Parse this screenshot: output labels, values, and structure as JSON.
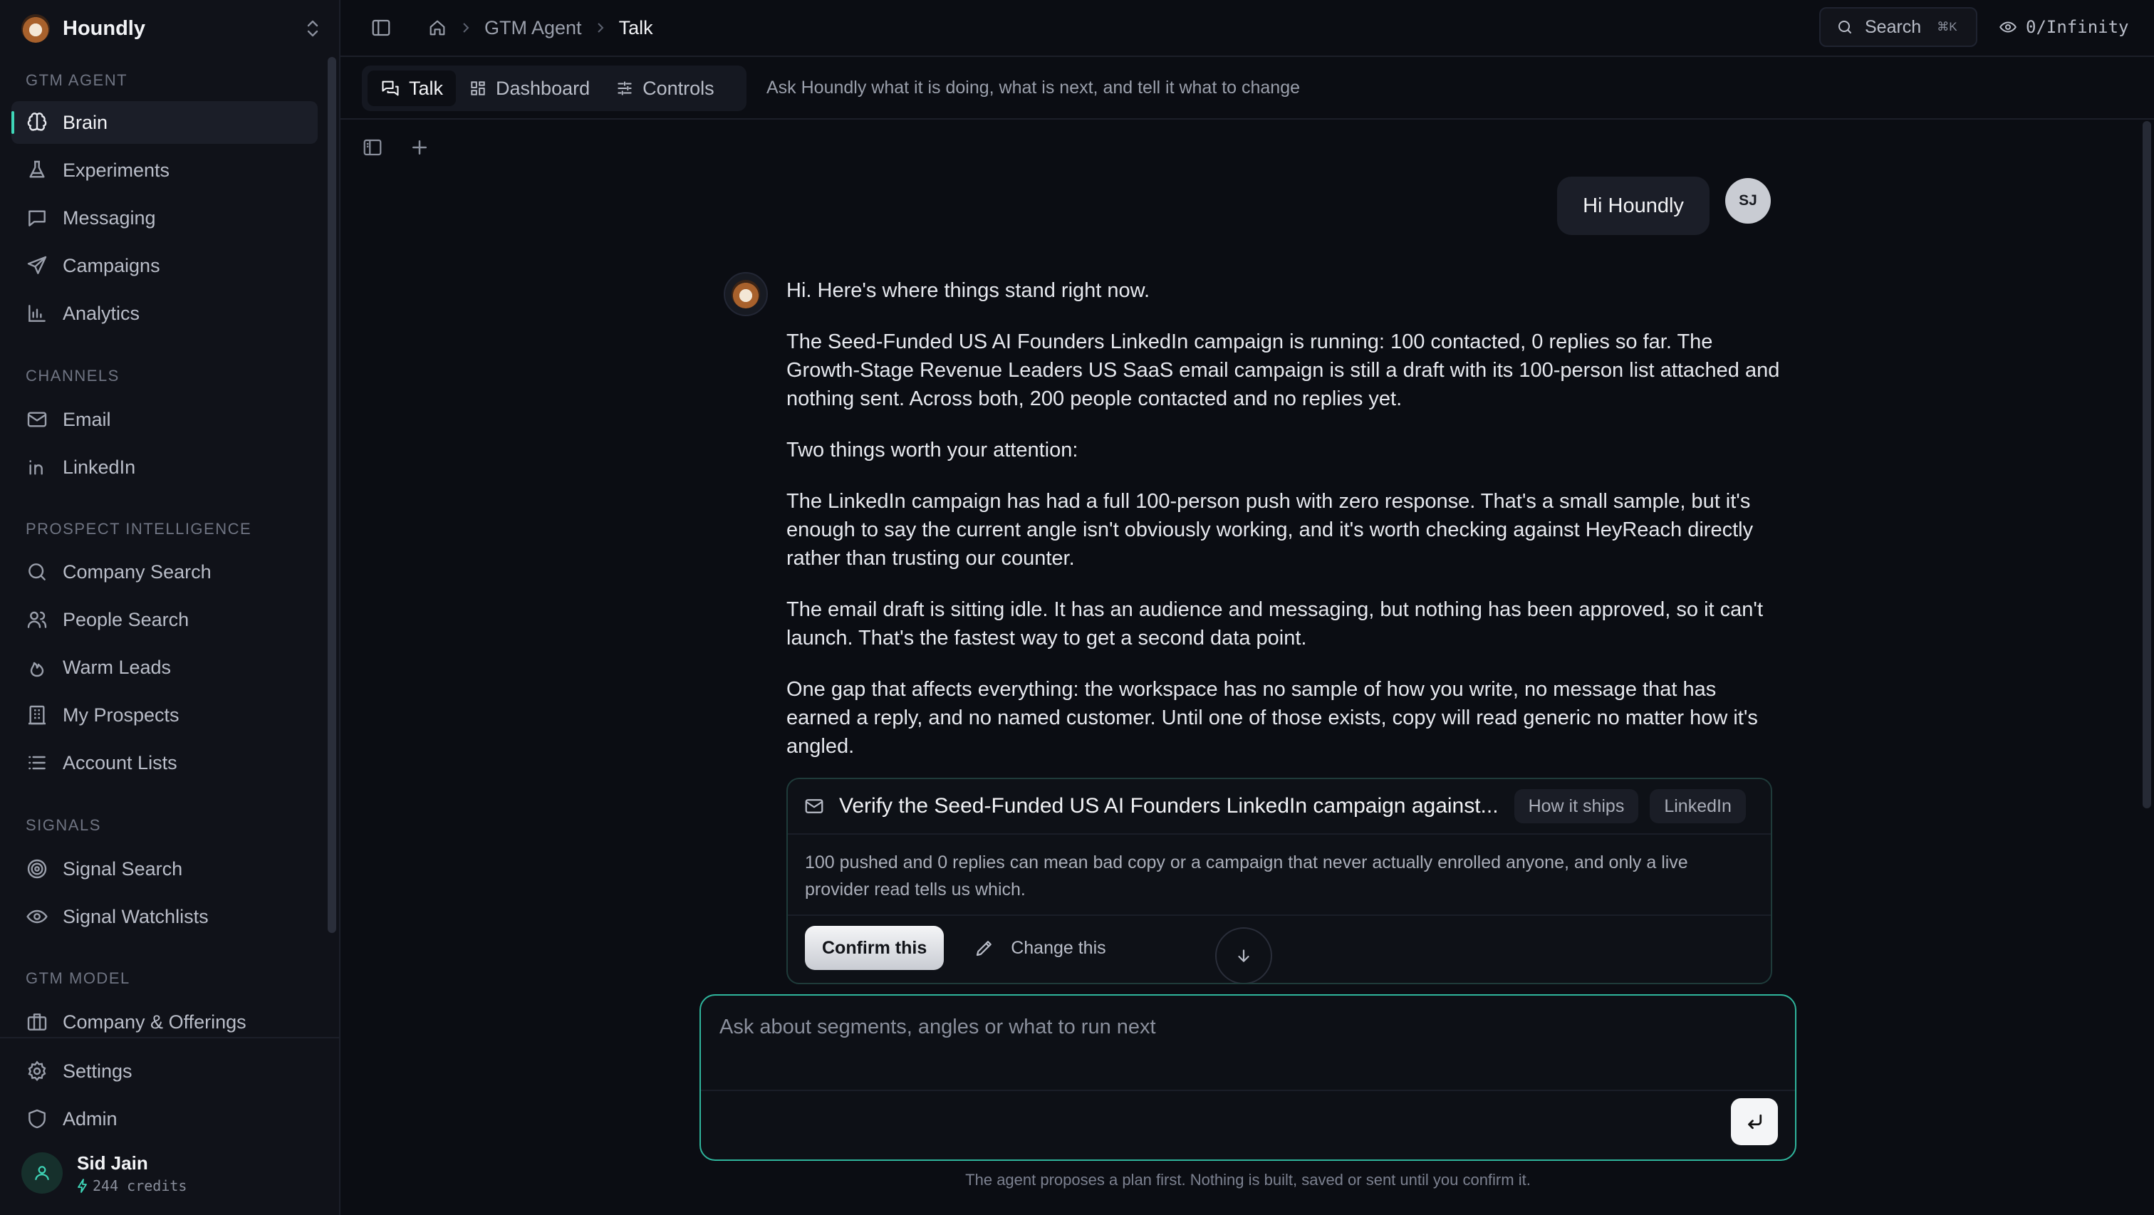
{
  "sidebar": {
    "brand": "Houndly",
    "sections": [
      {
        "label": "GTM AGENT",
        "items": [
          {
            "label": "Brain",
            "icon": "brain-icon",
            "active": true
          },
          {
            "label": "Experiments",
            "icon": "flask-icon"
          },
          {
            "label": "Messaging",
            "icon": "message-icon"
          },
          {
            "label": "Campaigns",
            "icon": "send-icon"
          },
          {
            "label": "Analytics",
            "icon": "bar-chart-icon"
          }
        ]
      },
      {
        "label": "CHANNELS",
        "items": [
          {
            "label": "Email",
            "icon": "mail-icon"
          },
          {
            "label": "LinkedIn",
            "icon": "linkedin-icon"
          }
        ]
      },
      {
        "label": "PROSPECT INTELLIGENCE",
        "items": [
          {
            "label": "Company Search",
            "icon": "search-icon"
          },
          {
            "label": "People Search",
            "icon": "people-icon"
          },
          {
            "label": "Warm Leads",
            "icon": "flame-icon"
          },
          {
            "label": "My Prospects",
            "icon": "building-icon"
          },
          {
            "label": "Account Lists",
            "icon": "list-icon"
          }
        ]
      },
      {
        "label": "SIGNALS",
        "items": [
          {
            "label": "Signal Search",
            "icon": "target-icon"
          },
          {
            "label": "Signal Watchlists",
            "icon": "eye-icon"
          }
        ]
      },
      {
        "label": "GTM MODEL",
        "items": [
          {
            "label": "Company & Offerings",
            "icon": "briefcase-icon"
          }
        ]
      }
    ],
    "bottom": [
      {
        "label": "Settings",
        "icon": "gear-icon"
      },
      {
        "label": "Admin",
        "icon": "shield-icon"
      }
    ],
    "user": {
      "name": "Sid Jain",
      "credits": "244 credits"
    }
  },
  "topbar": {
    "breadcrumb": [
      "GTM Agent",
      "Talk"
    ],
    "search_label": "Search",
    "search_shortcut": "⌘K",
    "usage": "0/Infinity"
  },
  "tabs": [
    {
      "label": "Talk",
      "icon": "chat-icon",
      "active": true
    },
    {
      "label": "Dashboard",
      "icon": "grid-icon"
    },
    {
      "label": "Controls",
      "icon": "sliders-icon"
    }
  ],
  "tab_hint": "Ask Houndly what it is doing, what is next, and tell it what to change",
  "chat": {
    "user_message": "Hi Houndly",
    "user_initials": "SJ",
    "agent_paragraphs": [
      "Hi. Here's where things stand right now.",
      "The Seed-Funded US AI Founders LinkedIn campaign is running: 100 contacted, 0 replies so far. The Growth-Stage Revenue Leaders US SaaS email campaign is still a draft with its 100-person list attached and nothing sent. Across both, 200 people contacted and no replies yet.",
      "Two things worth your attention:",
      "The LinkedIn campaign has had a full 100-person push with zero response. That's a small sample, but it's enough to say the current angle isn't obviously working, and it's worth checking against HeyReach directly rather than trusting our counter.",
      "The email draft is sitting idle. It has an audience and messaging, but nothing has been approved, so it can't launch. That's the fastest way to get a second data point.",
      "One gap that affects everything: the workspace has no sample of how you write, no message that has earned a reply, and no named customer. Until one of those exists, copy will read generic no matter how it's angled."
    ],
    "card": {
      "title": "Verify the Seed-Funded US AI Founders LinkedIn campaign against...",
      "tags": [
        "How it ships",
        "LinkedIn"
      ],
      "body": "100 pushed and 0 replies can mean bad copy or a campaign that never actually enrolled anyone, and only a live provider read tells us which.",
      "confirm_label": "Confirm this",
      "change_label": "Change this"
    }
  },
  "composer": {
    "placeholder": "Ask about segments, angles or what to run next",
    "value": ""
  },
  "footer_note": "The agent proposes a plan first. Nothing is built, saved or sent until you confirm it.",
  "colors": {
    "accent": "#3fd6b8",
    "background": "#0b0d13",
    "sidebar": "#101219"
  }
}
